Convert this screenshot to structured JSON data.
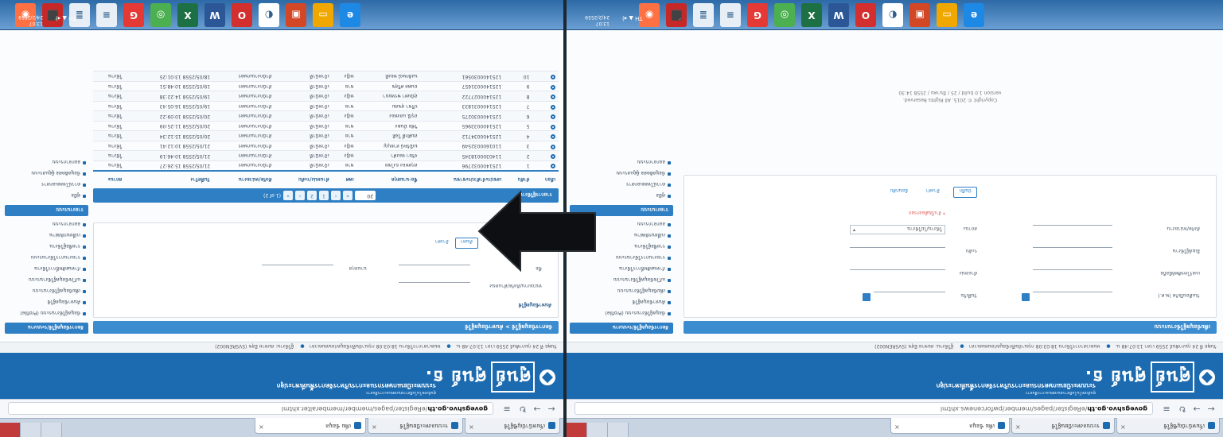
{
  "browser": {
    "url_host": "govegshvo.go.th",
    "url_path_left": "/eRegister/pages/member/memberalter.xhtml",
    "url_path_right": "/eRegister/pages/member/pwforcenews.xhtml",
    "tabs": [
      "เริ่มหน้าบัญชีผู้ใช้",
      "ระบบลงทะเบียนผู้ใช้",
      "เพิ่ม ข้อมูล"
    ]
  },
  "site": {
    "logo_text": "ศูนย์ ธ.",
    "logo_pill": "ศูนย์",
    "tagline": "ระบบทะเบียนเกษตรกรและการบริหารจัดการพื้นที่เพาะปลูก",
    "subtag": "ศูนย์เทคโนโลยีสารสนเทศและการสื่อสาร",
    "info_date": "วันพุธ ที่ 24 กุมภาพันธ์ 2559 เวลา 13:07:48 น.",
    "info_session": "หมดเวลาการใช้งาน 18:03:08 กรุณาบันทึกข้อมูลก่อนหมดเวลา",
    "info_user": "ผู้ใช้งาน: สมชาย มีสุข (SVSREN002)"
  },
  "sidebar": {
    "head_main": "จัดการข้อมูลผู้ใช้/ระบบงาน",
    "items_main": [
      "ข้อมูลผู้ใช้งานระบบ (Profile)",
      "ค้นหาข้อมูลผู้ใช้",
      "เพิ่มข้อมูลผู้ใช้งานระบบ",
      "แก้ไขข้อมูลผู้ใช้งานระบบ",
      "กำหนดสิทธิ์การใช้งาน",
      "รายงานการใช้งานระบบ",
      "รายชื่อผู้ใช้งาน",
      "เปลี่ยนรหัสผ่าน",
      "ออกจากระบบ"
    ],
    "head_report": "รายงานระบบ",
    "items_report": [
      "คู่มือ",
      "ดาวน์โหลดเอกสาร",
      "ข้อมูลติดต่อ ผู้ดูแลระบบ",
      "ออกจากระบบ"
    ]
  },
  "left": {
    "panel_title": "จัดการข้อมูลผู้ใช้ > ค้นหาข้อมูลผู้ใช้",
    "search_label": "ค้นหาข้อมูลผู้ใช้",
    "field_org": "หน่วยงาน/สังกัด/ตำแหน่ง",
    "field_name": "ชื่อ",
    "field_surname": "นามสกุล",
    "btn_search": "ค้นหา",
    "btn_clear": "ล้างค่า",
    "table_label": "รายการผู้ใช้งาน",
    "page_info": "(1 of 2)",
    "page_size": "20",
    "pages": [
      "«",
      "‹",
      "1",
      "2",
      "›",
      "»"
    ],
    "columns": [
      "เลือก",
      "ลำดับ",
      "เลขประจำตัวประชาชน",
      "ชื่อ-นามสกุล",
      "เพศ",
      "ตำแหน่ง/ระดับ",
      "สังกัด/หน่วยงาน",
      "วันที่สร้าง",
      "สถานะ"
    ],
    "rows": [
      [
        "1",
        "1251400032796",
        "สกุลทอง ธงไชย",
        "ชาย",
        "เจ้าหน้าที่",
        "สำนักงานเกษตร",
        "21/05/2558 15:26:27",
        "ใช้งาน"
      ],
      [
        "2",
        "1140300018345",
        "จริยา ทองคำ",
        "หญิง",
        "เจ้าหน้าที่",
        "สำนักงานเกษตร",
        "21/05/2558 10:46:19",
        "ใช้งาน"
      ],
      [
        "3",
        "1101600032549",
        "มณีรัตน์ สายบุญ",
        "หญิง",
        "เจ้าหน้าที่",
        "สำนักงานเกษตร",
        "21/05/2558 10:12:41",
        "ใช้งาน"
      ],
      [
        "4",
        "1251400034712",
        "สมศักดิ์ ใจดี",
        "ชาย",
        "เจ้าหน้าที่",
        "สำนักงานเกษตร",
        "20/05/2558 15:12:34",
        "ใช้งาน"
      ],
      [
        "5",
        "1251400033965",
        "วิชัย มั่นคง",
        "ชาย",
        "เจ้าหน้าที่",
        "สำนักงานเกษตร",
        "20/05/2558 11:25:09",
        "ใช้งาน"
      ],
      [
        "6",
        "1251400030275",
        "อรุณี แสงทอง",
        "หญิง",
        "เจ้าหน้าที่",
        "สำนักงานเกษตร",
        "20/05/2558 10:09:22",
        "ใช้งาน"
      ],
      [
        "7",
        "1251400031833",
        "ปรีชา สุขสม",
        "ชาย",
        "เจ้าหน้าที่",
        "สำนักงานเกษตร",
        "19/05/2558 16:05:43",
        "ใช้งาน"
      ],
      [
        "8",
        "1251400027722",
        "สุนันทา พรหมมา",
        "หญิง",
        "เจ้าหน้าที่",
        "สำนักงานเกษตร",
        "19/05/2558 14:22:38",
        "ใช้งาน"
      ],
      [
        "9",
        "1251400031657",
        "ธนพล ศรีสุข",
        "ชาย",
        "เจ้าหน้าที่",
        "สำนักงานเกษตร",
        "19/05/2558 10:48:51",
        "ใช้งาน"
      ],
      [
        "10",
        "1251400030561",
        "นงลักษณ์ ทองดี",
        "หญิง",
        "เจ้าหน้าที่",
        "สำนักงานเกษตร",
        "18/05/2558 13:01:25",
        "ใช้งาน"
      ]
    ]
  },
  "right": {
    "panel_title": "เพิ่มข้อมูลผู้ใช้งานระบบ",
    "lbl_birth": "วันเดือนปีเกิด (พ.ศ.)",
    "lbl_phone": "เบอร์โทรศัพท์มือถือ",
    "lbl_email": "อีเมล์ผู้ใช้งาน",
    "lbl_org": "สังกัด/หน่วยงาน",
    "lbl_start": "วันที่เริ่ม",
    "lbl_position": "ตำแหน่ง",
    "lbl_level": "ระดับ",
    "lbl_status": "สถานะ",
    "status_value": "ใช้งาน/ไม่ใช้งาน",
    "required_note": "* จำเป็นต้องกรอก",
    "btn_save": "บันทึก",
    "btn_clear": "ล้างค่า",
    "btn_back": "ย้อนกลับ",
    "copyright_1": "Copyright © 2015. All Rights Reserved.",
    "copyright_2": "version 1.0 build / 25 / มีนาคม / 2558 14:30"
  },
  "taskbar": {
    "clock_time": "13:07",
    "clock_date": "24/2/2559",
    "sys": "TH ▲ ◂)",
    "icons": [
      {
        "name": "ie-icon",
        "color": "#1e88e5",
        "glyph": "e"
      },
      {
        "name": "folder-icon",
        "color": "#f0a800",
        "glyph": "▭"
      },
      {
        "name": "word-doc-icon",
        "color": "#d24726",
        "glyph": "▣"
      },
      {
        "name": "app-icon",
        "color": "#ffffff",
        "glyph": "◐"
      },
      {
        "name": "opera-icon",
        "color": "#d32f2f",
        "glyph": "O"
      },
      {
        "name": "word-icon",
        "color": "#2b5797",
        "glyph": "W"
      },
      {
        "name": "excel-icon",
        "color": "#1d7044",
        "glyph": "X"
      },
      {
        "name": "chrome-icon",
        "color": "#4caf50",
        "glyph": "◎"
      },
      {
        "name": "recorder-icon",
        "color": "#e53935",
        "glyph": "G"
      },
      {
        "name": "notepad-icon",
        "color": "#e8eef5",
        "glyph": "≡"
      },
      {
        "name": "document-icon",
        "color": "#e8eef5",
        "glyph": "≣"
      },
      {
        "name": "acrobat-icon",
        "color": "#c62828",
        "glyph": "⬛"
      },
      {
        "name": "firefox-icon",
        "color": "#ff7043",
        "glyph": "◉"
      }
    ]
  }
}
